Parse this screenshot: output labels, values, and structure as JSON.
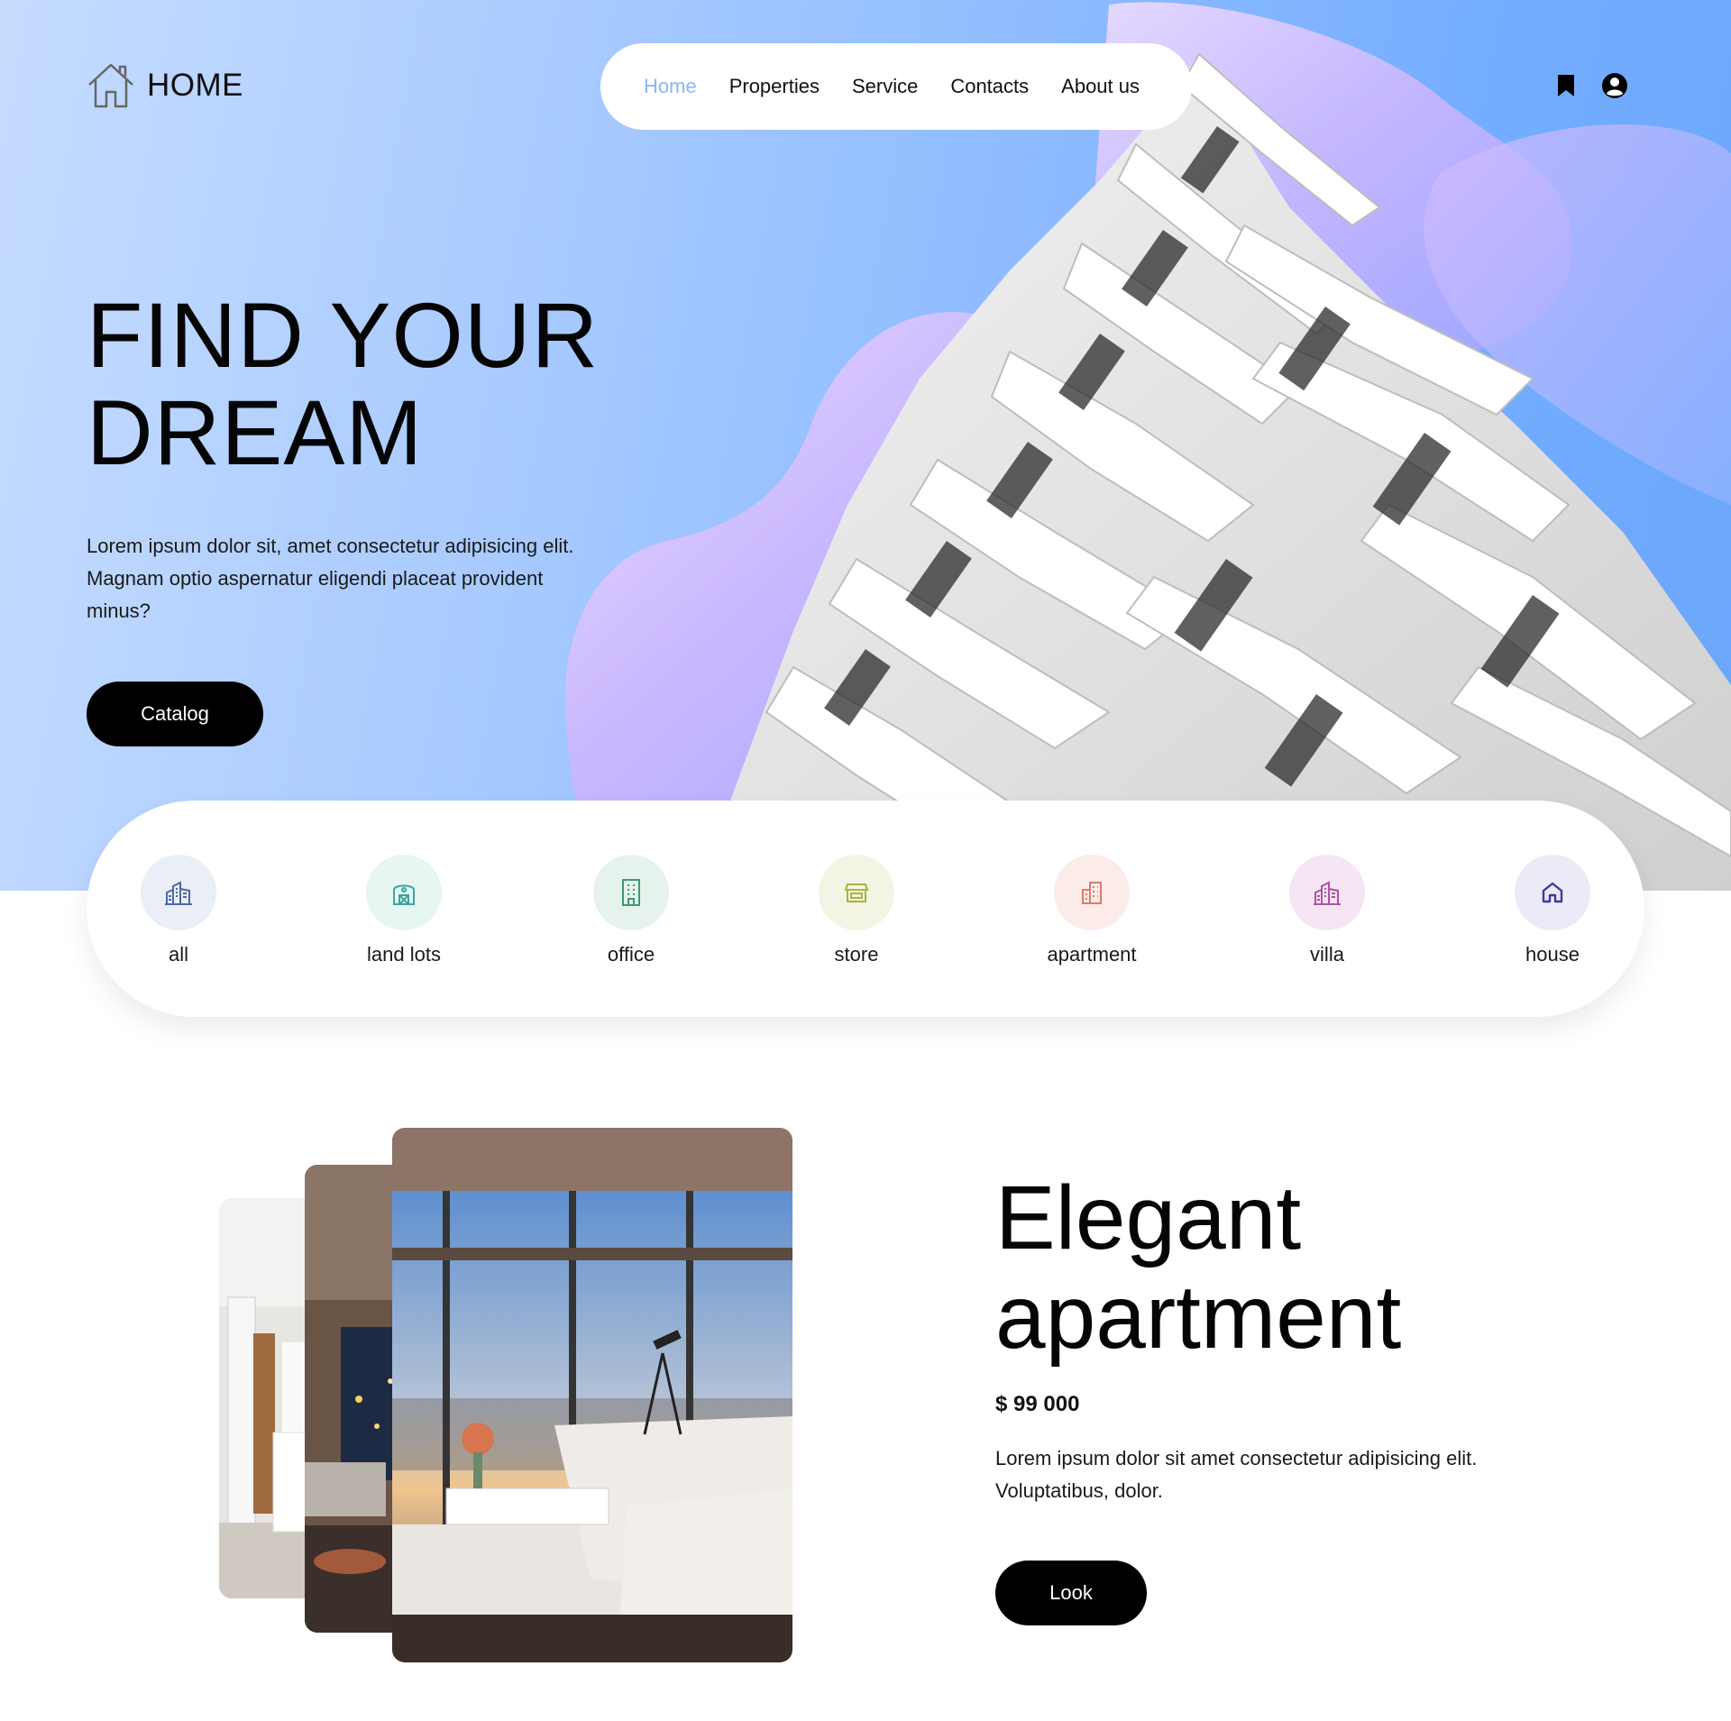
{
  "header": {
    "logo_text": "HOME",
    "nav": [
      {
        "label": "Home",
        "active": true
      },
      {
        "label": "Properties",
        "active": false
      },
      {
        "label": "Service",
        "active": false
      },
      {
        "label": "Contacts",
        "active": false
      },
      {
        "label": "About us",
        "active": false
      }
    ],
    "icons": [
      "bookmark-icon",
      "user-circle-icon"
    ]
  },
  "hero": {
    "title_line1": "FIND YOUR",
    "title_line2": "DREAM",
    "description": "Lorem ipsum dolor sit, amet consectetur adipisicing elit. Magnam optio aspernatur eligendi placeat provident minus?",
    "button_label": "Catalog"
  },
  "categories": [
    {
      "label": "all",
      "icon": "city-buildings-icon",
      "color": "#4a68a8",
      "bg": "#eaeef7"
    },
    {
      "label": "land lots",
      "icon": "barn-icon",
      "color": "#3aa5a0",
      "bg": "#e7f5f3"
    },
    {
      "label": "office",
      "icon": "office-building-icon",
      "color": "#3f9a6e",
      "bg": "#e6f3ec"
    },
    {
      "label": "store",
      "icon": "store-icon",
      "color": "#a9b43b",
      "bg": "#f3f5e4"
    },
    {
      "label": "apartment",
      "icon": "apartment-building-icon",
      "color": "#df7a6a",
      "bg": "#fbecea"
    },
    {
      "label": "villa",
      "icon": "villa-buildings-icon",
      "color": "#b24fa8",
      "bg": "#f6e6f4"
    },
    {
      "label": "house",
      "icon": "house-icon",
      "color": "#3d3aa0",
      "bg": "#ebeaf7"
    }
  ],
  "feature": {
    "title_line1": "Elegant",
    "title_line2": "apartment",
    "price": "$ 99 000",
    "description": "Lorem ipsum dolor sit amet consectetur adipisicing elit. Voluptatibus, dolor.",
    "button_label": "Look"
  },
  "colors": {
    "accent_nav_active": "#8ab6f5",
    "button_bg": "#000000",
    "hero_gradient_start": "#c6dcff",
    "hero_gradient_end": "#6aa6fb",
    "blob_purple": "#c7b5ff"
  }
}
